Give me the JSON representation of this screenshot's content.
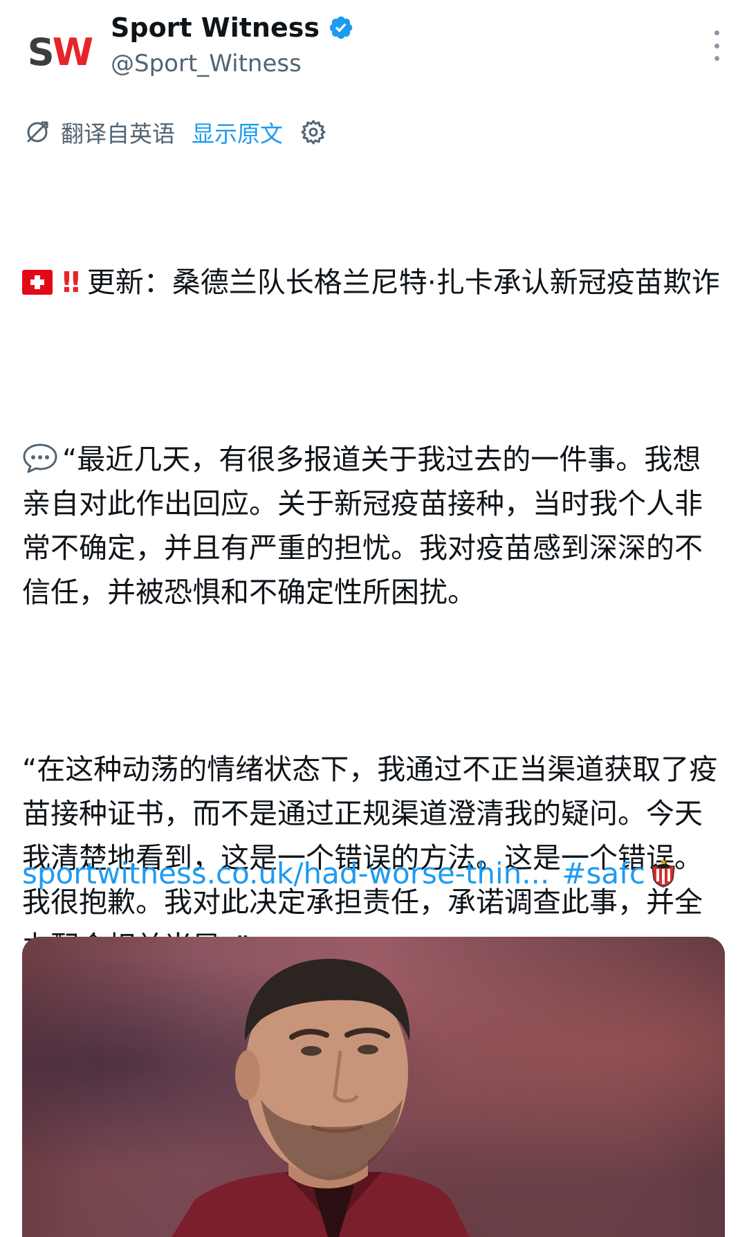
{
  "header": {
    "logo_letters": [
      "S",
      "W"
    ],
    "display_name": "Sport Witness",
    "handle": "@Sport_Witness",
    "verified": true,
    "verified_color": "#1d9bf0"
  },
  "translation": {
    "translated_from": "翻译自英语",
    "show_original": "显示原文"
  },
  "tweet": {
    "headline": "更新：桑德兰队长格兰尼特·扎卡承认新冠疫苗欺诈",
    "quote1": "“最近几天，有很多报道关于我过去的一件事。我想亲自对此作出回应。关于新冠疫苗接种，当时我个人非常不确定，并且有严重的担忧。我对疫苗感到深深的不信任，并被恐惧和不确定性所困扰。",
    "quote2": "“在这种动荡的情绪状态下，我通过不正当渠道获取了疫苗接种证书，而不是通过正规渠道澄清我的疑问。今天我清楚地看到，这是一个错误的方法。这是一个错误。我很抱歉。我对此决定承担责任，承诺调查此事，并全力配合相关当局。”",
    "link_text": "sportwitness.co.uk/had-worse-thin...",
    "hashtag": "#safc"
  },
  "colors": {
    "link": "#1d9bf0",
    "text": "#0f1419",
    "secondary": "#536471",
    "brand_red": "#e8232a",
    "swiss_red": "#e30a17"
  },
  "icons": {
    "translate": "translate-icon",
    "settings": "settings-gear-icon",
    "more": "more-vertical-icon",
    "flag": "swiss-flag-icon",
    "exclamation": "double-exclamation-icon",
    "speech": "speech-bubble-icon",
    "crest": "sunderland-crest-icon"
  }
}
